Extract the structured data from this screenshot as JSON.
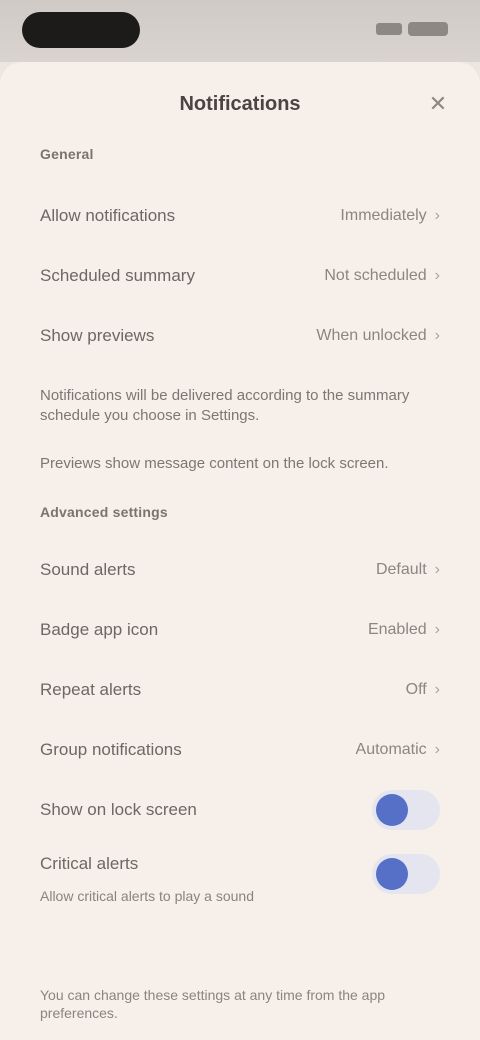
{
  "header": {
    "title": "Notifications",
    "close_icon": "close-icon"
  },
  "general": {
    "label": "General",
    "rows": [
      {
        "label": "Allow notifications",
        "value": "Immediately"
      },
      {
        "label": "Scheduled summary",
        "value": "Not scheduled"
      },
      {
        "label": "Show previews",
        "value": "When unlocked"
      }
    ],
    "note1": "Notifications will be delivered according to the summary schedule you choose in Settings.",
    "note2": "Previews show message content on the lock screen."
  },
  "advanced": {
    "label": "Advanced settings",
    "rows": [
      {
        "label": "Sound alerts",
        "value": "Default"
      },
      {
        "label": "Badge app icon",
        "value": "Enabled"
      },
      {
        "label": "Repeat alerts",
        "value": "Off"
      },
      {
        "label": "Group notifications",
        "value": "Automatic"
      }
    ],
    "toggles": [
      {
        "label": "Show on lock screen",
        "on": true
      },
      {
        "label": "Critical alerts",
        "sub": "Allow critical alerts to play a sound",
        "on": true
      }
    ]
  },
  "footer": {
    "text": "You can change these settings at any time from the app preferences."
  },
  "colors": {
    "accent": "#5670c8",
    "background": "#f6efea"
  }
}
